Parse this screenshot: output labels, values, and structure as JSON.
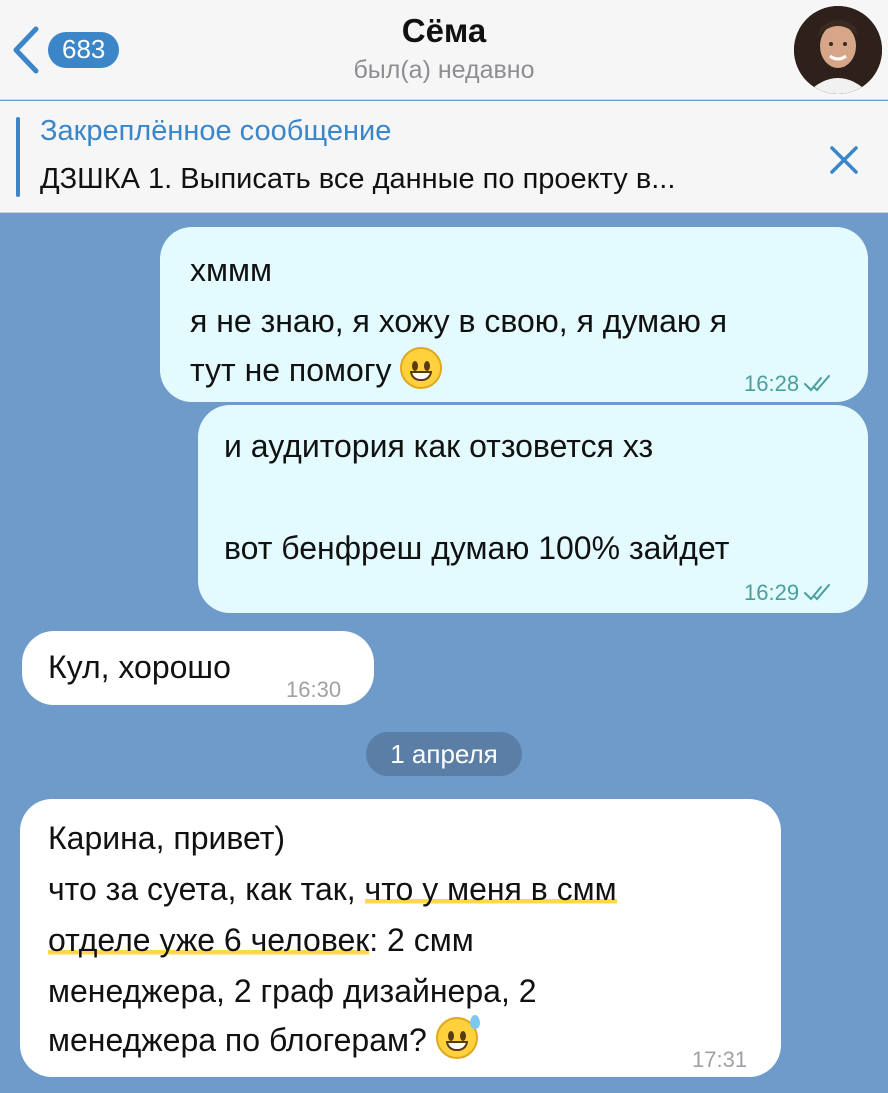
{
  "header": {
    "back_count": "683",
    "contact_name": "Сёма",
    "status": "был(а) недавно"
  },
  "pinned": {
    "title": "Закреплённое сообщение",
    "text": "ДЗШКА 1. Выписать все данные по проекту в..."
  },
  "messages": [
    {
      "direction": "out",
      "lines": [
        "хммм",
        "я не знаю, я хожу в свою, я думаю я",
        "тут не помогу"
      ],
      "emoji": "grinning-face",
      "time": "16:28"
    },
    {
      "direction": "out",
      "lines": [
        "и аудитория как отзовется хз",
        "",
        "вот бенфреш думаю 100% зайдет"
      ],
      "time": "16:29"
    },
    {
      "direction": "in",
      "lines": [
        "Кул, хорошо"
      ],
      "time": "16:30"
    }
  ],
  "date_separator": "1 апреля",
  "last_message": {
    "direction": "in",
    "line1": "Карина, привет)",
    "line2_a": "что за суета, как так, ",
    "line2_b": "что у меня в смм",
    "line3_a": "отделе уже 6 человек",
    "line3_b": ": 2 смм",
    "line4": "менеджера, 2 граф дизайнера, 2",
    "line5": "менеджера по блогерам?",
    "emoji": "grinning-face-with-sweat",
    "time": "17:31"
  },
  "colors": {
    "accent": "#3a86c8",
    "chat_background": "#6e9bc9",
    "outgoing_bubble": "#e3fbff",
    "incoming_bubble": "#ffffff"
  }
}
